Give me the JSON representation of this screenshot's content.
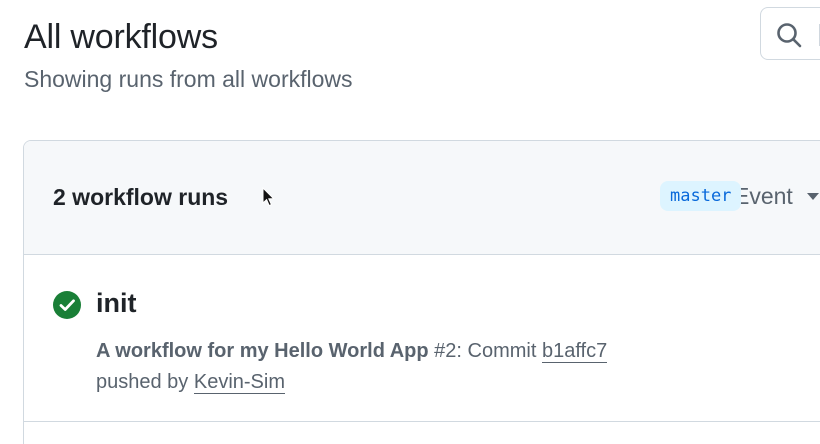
{
  "header": {
    "title": "All workflows",
    "subtitle": "Showing runs from all workflows"
  },
  "search": {
    "icon": "search-icon"
  },
  "runs": {
    "count_label": "2 workflow runs",
    "filter_label": "Event",
    "items": [
      {
        "title": "init",
        "status": "success",
        "status_color": "#1a7f37",
        "workflow_name": "A workflow for my Hello World App",
        "run_number": "#2",
        "commit_prefix": ": Commit",
        "commit_sha": "b1affc7",
        "pushed_by_prefix": "pushed by",
        "actor": "Kevin-Sim",
        "branch": "master"
      }
    ]
  },
  "colors": {
    "accent_blue": "#0969da",
    "badge_bg": "#ddf4ff",
    "success_green": "#1a7f37",
    "header_bg": "#f6f8fa",
    "border": "#d1d9e0"
  }
}
